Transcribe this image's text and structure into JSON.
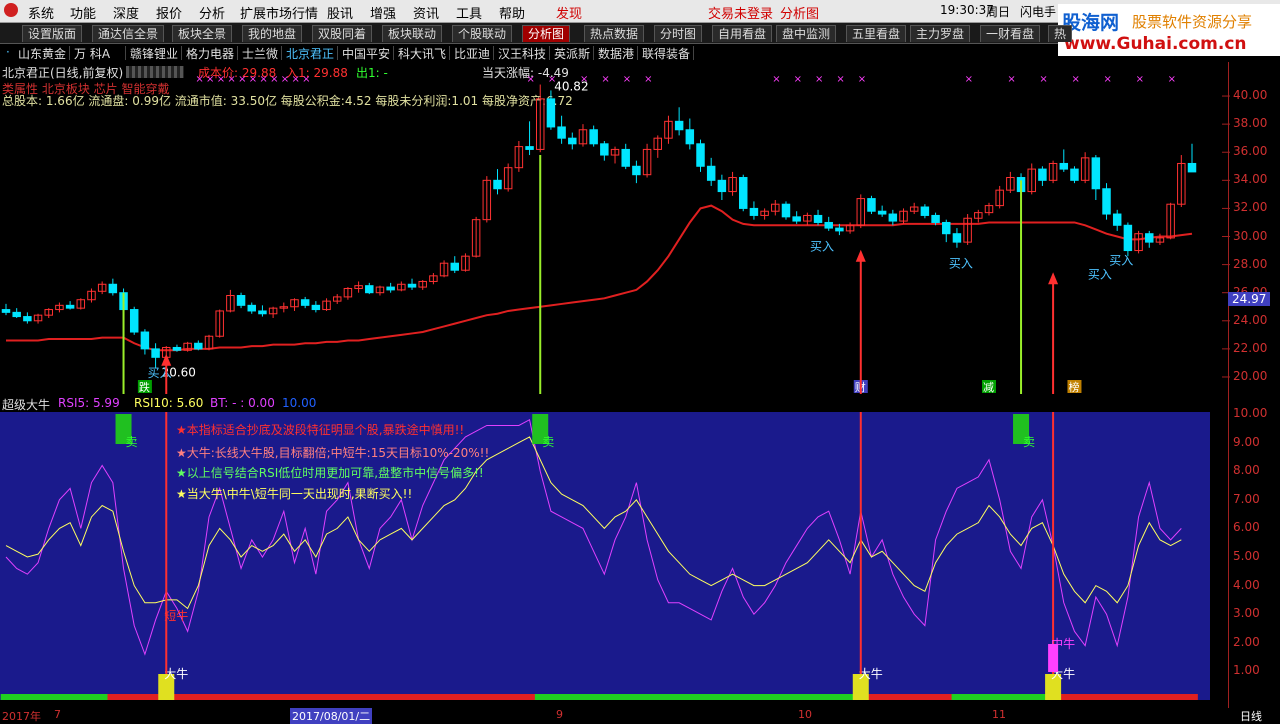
{
  "menu": {
    "items": [
      "系统",
      "功能",
      "深度",
      "报价",
      "分析",
      "扩展市场行情",
      "股讯",
      "增强",
      "资讯",
      "工具",
      "帮助",
      "发现"
    ],
    "trade_status": "交易未登录",
    "analysis_label": "分析图",
    "clock": "19:30:37",
    "weekday": "周日",
    "flash_label": "闪电手"
  },
  "logo": {
    "brand": "股海网",
    "slogan": "股票软件资源分享",
    "url": "www.Guhai.com.cn"
  },
  "tabs": [
    "设置版面",
    "通达信全景",
    "板块全景",
    "我的地盘",
    "双股同着",
    "板块联动",
    "个股联动",
    "分析图",
    "热点数据",
    "分时图",
    "自用看盘",
    "盘中监测",
    "五里看盘",
    "主力罗盘",
    "一财看盘",
    "热"
  ],
  "active_tab": 7,
  "stocks": [
    "山东黄金",
    "万 科A",
    "赣锋锂业",
    "格力电器",
    "士兰微",
    "北京君正",
    "中国平安",
    "科大讯飞",
    "比亚迪",
    "汉王科技",
    "英派斯",
    "数据港",
    "联得装备"
  ],
  "active_stock": 5,
  "chart_header": {
    "stock": "北京君正(日线,前复权)",
    "cost_label": "成本价: 29.88",
    "in_label": "入1: 29.88",
    "out_label": "出1: -",
    "change_label": "当天涨幅: -4.49",
    "fund_line": "总股本: 1.66亿 流通盘: 0.99亿 流通市值: 33.50亿 每股公积金:4.52 每股未分利润:1.01 每股净资产:6.72",
    "tag_line": "类属性 北京板块 芯片 智能穿戴"
  },
  "price_axis": {
    "ticks": [
      "40.00",
      "38.00",
      "36.00",
      "34.00",
      "32.00",
      "30.00",
      "28.00",
      "26.00",
      "24.00",
      "22.00",
      "20.00"
    ],
    "current": "24.97"
  },
  "annotations": {
    "high": "40.82",
    "low": "20.60",
    "buy_labels": [
      "买入",
      "买入",
      "买入",
      "买入",
      "买入"
    ],
    "flags": [
      "跌",
      "财",
      "减",
      "榜"
    ]
  },
  "lower_header": {
    "name": "超级大牛",
    "rsi5": "RSI5: 5.99",
    "rsi10": "RSI10: 5.60",
    "bt": "BT: - : 0.00",
    "ten": "10.00"
  },
  "lower_axis": {
    "ticks": [
      "10.00",
      "9.00",
      "8.00",
      "7.00",
      "6.00",
      "5.00",
      "4.00",
      "3.00",
      "2.00",
      "1.00"
    ]
  },
  "notes": [
    "★本指标适合抄底及波段特征明显个股,暴跌途中慎用!!",
    "★大牛:长线大牛股,目标翻倍;中短牛:15天目标10%-20%!!",
    "★以上信号结合RSI低位时用更加可靠,盘整市中信号偏多!!",
    "★当大牛\\中牛\\短牛同一天出现时,果断买入!!"
  ],
  "signals": {
    "sell": "卖",
    "big_bull": "大牛",
    "short_bull": "短牛",
    "mid_bull": "中牛"
  },
  "date_axis": {
    "labels": [
      "2017年",
      "7",
      "2017/08/01/二",
      "9",
      "10",
      "11"
    ],
    "period": "日线"
  },
  "colors": {
    "up": "#ff3232",
    "down": "#00e5ff",
    "ma": "#e02020",
    "panel": "#1a1a8c",
    "rsi_a": "#ffff60",
    "rsi_b": "#e040ff"
  },
  "chart_data": {
    "type": "candlestick",
    "ylim": [
      19.5,
      41
    ],
    "candles": [
      [
        24.8,
        25.2,
        24.4,
        24.6
      ],
      [
        24.6,
        24.9,
        24.2,
        24.3
      ],
      [
        24.3,
        24.6,
        23.8,
        24.0
      ],
      [
        24.0,
        24.5,
        23.8,
        24.4
      ],
      [
        24.4,
        24.9,
        24.2,
        24.8
      ],
      [
        24.8,
        25.3,
        24.6,
        25.1
      ],
      [
        25.1,
        25.4,
        24.8,
        24.9
      ],
      [
        24.9,
        25.6,
        24.8,
        25.5
      ],
      [
        25.5,
        26.3,
        25.3,
        26.1
      ],
      [
        26.1,
        26.8,
        25.9,
        26.6
      ],
      [
        26.6,
        27.0,
        25.8,
        26.0
      ],
      [
        26.0,
        26.3,
        24.6,
        24.8
      ],
      [
        24.8,
        25.0,
        23.0,
        23.2
      ],
      [
        23.2,
        23.4,
        21.6,
        22.0
      ],
      [
        22.0,
        22.4,
        20.6,
        21.4
      ],
      [
        21.4,
        22.2,
        21.3,
        22.1
      ],
      [
        22.1,
        22.3,
        21.8,
        21.9
      ],
      [
        21.9,
        22.5,
        21.8,
        22.4
      ],
      [
        22.4,
        22.6,
        21.9,
        22.0
      ],
      [
        22.0,
        23.0,
        21.9,
        22.9
      ],
      [
        22.9,
        24.8,
        22.8,
        24.7
      ],
      [
        24.7,
        26.2,
        24.6,
        25.8
      ],
      [
        25.8,
        26.0,
        24.9,
        25.1
      ],
      [
        25.1,
        25.3,
        24.5,
        24.7
      ],
      [
        24.7,
        25.1,
        24.3,
        24.5
      ],
      [
        24.5,
        25.0,
        24.2,
        24.9
      ],
      [
        24.9,
        25.3,
        24.6,
        25.0
      ],
      [
        25.0,
        25.6,
        24.7,
        25.5
      ],
      [
        25.5,
        25.7,
        24.9,
        25.1
      ],
      [
        25.1,
        25.4,
        24.6,
        24.8
      ],
      [
        24.8,
        25.6,
        24.7,
        25.4
      ],
      [
        25.4,
        25.9,
        25.2,
        25.7
      ],
      [
        25.7,
        26.4,
        25.5,
        26.3
      ],
      [
        26.3,
        26.8,
        26.0,
        26.5
      ],
      [
        26.5,
        26.7,
        25.9,
        26.0
      ],
      [
        26.0,
        26.5,
        25.8,
        26.4
      ],
      [
        26.4,
        26.7,
        26.0,
        26.2
      ],
      [
        26.2,
        26.8,
        26.1,
        26.6
      ],
      [
        26.6,
        27.0,
        26.2,
        26.4
      ],
      [
        26.4,
        26.9,
        26.2,
        26.8
      ],
      [
        26.8,
        27.4,
        26.6,
        27.2
      ],
      [
        27.2,
        28.3,
        27.1,
        28.1
      ],
      [
        28.1,
        28.6,
        27.4,
        27.6
      ],
      [
        27.6,
        28.8,
        27.5,
        28.6
      ],
      [
        28.6,
        31.4,
        28.5,
        31.2
      ],
      [
        31.2,
        34.3,
        31.0,
        34.0
      ],
      [
        34.0,
        34.8,
        33.0,
        33.4
      ],
      [
        33.4,
        35.2,
        33.2,
        34.9
      ],
      [
        34.9,
        36.8,
        34.6,
        36.4
      ],
      [
        36.4,
        38.2,
        35.8,
        36.2
      ],
      [
        36.2,
        40.82,
        36.0,
        39.8
      ],
      [
        39.8,
        40.4,
        37.6,
        37.8
      ],
      [
        37.8,
        38.6,
        36.6,
        37.0
      ],
      [
        37.0,
        37.4,
        36.2,
        36.6
      ],
      [
        36.6,
        38.0,
        36.4,
        37.6
      ],
      [
        37.6,
        37.9,
        36.4,
        36.6
      ],
      [
        36.6,
        36.8,
        35.4,
        35.8
      ],
      [
        35.8,
        36.4,
        35.2,
        36.2
      ],
      [
        36.2,
        36.6,
        34.8,
        35.0
      ],
      [
        35.0,
        35.4,
        33.8,
        34.4
      ],
      [
        34.4,
        36.6,
        34.2,
        36.2
      ],
      [
        36.2,
        37.2,
        35.6,
        37.0
      ],
      [
        37.0,
        38.6,
        36.6,
        38.2
      ],
      [
        38.2,
        39.2,
        37.2,
        37.6
      ],
      [
        37.6,
        38.4,
        36.2,
        36.6
      ],
      [
        36.6,
        36.9,
        34.6,
        35.0
      ],
      [
        35.0,
        35.6,
        33.6,
        34.0
      ],
      [
        34.0,
        34.4,
        32.6,
        33.2
      ],
      [
        33.2,
        34.6,
        32.9,
        34.2
      ],
      [
        34.2,
        34.4,
        31.8,
        32.0
      ],
      [
        32.0,
        32.5,
        31.2,
        31.5
      ],
      [
        31.5,
        32.0,
        31.2,
        31.8
      ],
      [
        31.8,
        32.6,
        31.5,
        32.3
      ],
      [
        32.3,
        32.5,
        31.2,
        31.4
      ],
      [
        31.4,
        31.8,
        30.9,
        31.1
      ],
      [
        31.1,
        31.7,
        30.8,
        31.5
      ],
      [
        31.5,
        31.9,
        30.8,
        31.0
      ],
      [
        31.0,
        31.4,
        30.4,
        30.6
      ],
      [
        30.6,
        30.9,
        30.1,
        30.4
      ],
      [
        30.4,
        31.0,
        30.2,
        30.8
      ],
      [
        30.8,
        33.0,
        30.6,
        32.7
      ],
      [
        32.7,
        32.9,
        31.6,
        31.8
      ],
      [
        31.8,
        32.2,
        31.4,
        31.6
      ],
      [
        31.6,
        31.9,
        30.8,
        31.1
      ],
      [
        31.1,
        32.0,
        30.9,
        31.8
      ],
      [
        31.8,
        32.4,
        31.6,
        32.1
      ],
      [
        32.1,
        32.3,
        31.3,
        31.5
      ],
      [
        31.5,
        31.7,
        30.8,
        31.0
      ],
      [
        31.0,
        31.2,
        29.6,
        30.2
      ],
      [
        30.2,
        30.6,
        29.2,
        29.6
      ],
      [
        29.6,
        31.6,
        29.4,
        31.3
      ],
      [
        31.3,
        31.9,
        31.0,
        31.7
      ],
      [
        31.7,
        32.4,
        31.5,
        32.2
      ],
      [
        32.2,
        33.6,
        32.0,
        33.3
      ],
      [
        33.3,
        34.6,
        33.1,
        34.2
      ],
      [
        34.2,
        34.5,
        32.9,
        33.2
      ],
      [
        33.2,
        35.2,
        33.0,
        34.8
      ],
      [
        34.8,
        35.0,
        33.6,
        34.0
      ],
      [
        34.0,
        35.4,
        33.8,
        35.2
      ],
      [
        35.2,
        36.2,
        34.6,
        34.8
      ],
      [
        34.8,
        35.0,
        33.8,
        34.0
      ],
      [
        34.0,
        36.0,
        33.8,
        35.6
      ],
      [
        35.6,
        35.8,
        32.6,
        33.4
      ],
      [
        33.4,
        33.8,
        31.2,
        31.6
      ],
      [
        31.6,
        31.9,
        30.4,
        30.8
      ],
      [
        30.8,
        31.0,
        28.6,
        29.0
      ],
      [
        29.0,
        30.4,
        28.8,
        30.2
      ],
      [
        30.2,
        30.4,
        29.2,
        29.6
      ],
      [
        29.6,
        30.2,
        29.4,
        29.9
      ],
      [
        29.9,
        32.4,
        29.8,
        32.3
      ],
      [
        32.3,
        35.8,
        32.1,
        35.2
      ],
      [
        35.2,
        36.6,
        34.8,
        34.6
      ]
    ],
    "ma": [
      22.6,
      22.6,
      22.6,
      22.6,
      22.7,
      22.7,
      22.7,
      22.7,
      22.7,
      22.8,
      22.8,
      22.8,
      22.4,
      22.1,
      21.9,
      21.9,
      21.9,
      22.0,
      22.0,
      22.0,
      22.1,
      22.1,
      22.1,
      22.2,
      22.2,
      22.3,
      22.3,
      22.3,
      22.4,
      22.4,
      22.5,
      22.5,
      22.6,
      22.6,
      22.7,
      22.8,
      22.9,
      23.0,
      23.1,
      23.2,
      23.4,
      23.6,
      23.8,
      24.0,
      24.2,
      24.4,
      24.5,
      24.7,
      24.8,
      24.9,
      25.0,
      25.1,
      25.2,
      25.3,
      25.4,
      25.5,
      25.6,
      25.8,
      26.0,
      26.2,
      26.8,
      27.6,
      28.6,
      29.8,
      31.0,
      32.0,
      32.2,
      31.8,
      31.2,
      30.9,
      30.8,
      30.8,
      30.8,
      30.8,
      30.8,
      30.8,
      30.8,
      30.8,
      30.8,
      30.8,
      30.8,
      30.8,
      30.8,
      30.8,
      30.9,
      30.9,
      30.9,
      30.9,
      30.9,
      30.9,
      30.9,
      30.9,
      31.0,
      31.0,
      31.0,
      31.0,
      31.0,
      31.0,
      31.0,
      31.0,
      31.0,
      30.8,
      30.5,
      30.2,
      30.0,
      29.8,
      29.8,
      29.9,
      30.0,
      30.0,
      30.1,
      30.2
    ],
    "rsi_a": [
      5.4,
      5.2,
      5.0,
      5.1,
      5.6,
      6.0,
      6.2,
      5.4,
      6.4,
      6.8,
      6.6,
      5.2,
      4.0,
      3.4,
      3.4,
      3.5,
      3.5,
      3.2,
      4.0,
      5.4,
      6.0,
      5.6,
      5.0,
      5.4,
      5.2,
      5.4,
      5.8,
      5.2,
      5.6,
      5.0,
      5.8,
      6.0,
      6.4,
      5.6,
      5.2,
      5.6,
      5.8,
      6.0,
      5.6,
      6.0,
      6.4,
      6.8,
      7.0,
      7.4,
      8.0,
      8.4,
      8.6,
      8.8,
      9.0,
      9.2,
      8.4,
      7.6,
      7.2,
      7.0,
      6.8,
      6.4,
      6.0,
      6.4,
      6.6,
      7.0,
      6.4,
      5.8,
      5.2,
      4.8,
      4.4,
      4.2,
      4.0,
      4.2,
      4.4,
      4.2,
      4.0,
      4.0,
      4.2,
      4.4,
      4.6,
      4.8,
      5.2,
      5.6,
      5.2,
      4.8,
      5.6,
      5.0,
      5.2,
      4.8,
      4.4,
      4.0,
      3.8,
      4.8,
      5.4,
      5.8,
      6.0,
      6.2,
      6.8,
      6.4,
      5.8,
      5.4,
      6.0,
      6.2,
      5.4,
      4.4,
      3.8,
      3.4,
      4.0,
      3.8,
      3.4,
      4.0,
      5.4,
      6.2,
      5.6,
      5.4,
      5.6
    ],
    "rsi_b": [
      5.0,
      4.6,
      4.4,
      4.8,
      6.0,
      7.0,
      7.4,
      6.0,
      7.6,
      8.2,
      7.6,
      4.6,
      2.6,
      1.6,
      2.8,
      3.8,
      3.2,
      2.4,
      3.8,
      6.4,
      7.4,
      6.0,
      4.6,
      5.6,
      5.0,
      5.6,
      6.6,
      4.8,
      6.0,
      4.4,
      6.6,
      7.0,
      7.6,
      5.6,
      4.6,
      6.0,
      6.4,
      7.0,
      5.6,
      6.8,
      7.6,
      8.4,
      8.8,
      9.2,
      9.4,
      9.6,
      9.6,
      9.6,
      9.6,
      9.8,
      8.0,
      6.6,
      6.4,
      6.2,
      6.0,
      5.2,
      4.4,
      5.6,
      6.4,
      7.6,
      5.6,
      4.2,
      3.4,
      3.4,
      3.2,
      3.0,
      2.8,
      3.8,
      4.6,
      3.6,
      3.0,
      3.4,
      4.0,
      4.8,
      5.4,
      6.0,
      6.4,
      6.6,
      5.6,
      4.4,
      6.6,
      5.0,
      5.6,
      4.4,
      3.6,
      3.0,
      2.6,
      5.6,
      6.6,
      7.4,
      7.6,
      7.8,
      8.4,
      7.0,
      5.2,
      4.6,
      6.4,
      7.0,
      5.4,
      3.4,
      2.4,
      1.9,
      3.6,
      3.0,
      1.9,
      3.6,
      6.4,
      7.6,
      6.0,
      5.6,
      6.0
    ]
  }
}
